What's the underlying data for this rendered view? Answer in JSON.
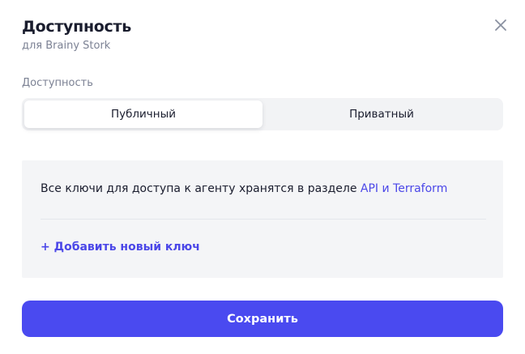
{
  "dialog": {
    "title": "Доступность",
    "subtitle": "для Brainy Stork",
    "close_icon": "close-icon"
  },
  "access": {
    "label": "Доступность",
    "options": [
      "Публичный",
      "Приватный"
    ],
    "selected": "Публичный"
  },
  "keys_panel": {
    "info_text": "Все ключи для доступа к агенту хранятся в разделе ",
    "info_link": "API и Terraform",
    "add_key": "+ Добавить новый ключ"
  },
  "actions": {
    "save_label": "Сохранить"
  },
  "colors": {
    "accent": "#4a4af0",
    "link": "#4b47e8",
    "muted_text": "#7c8294",
    "panel_bg": "#f4f5f7"
  }
}
